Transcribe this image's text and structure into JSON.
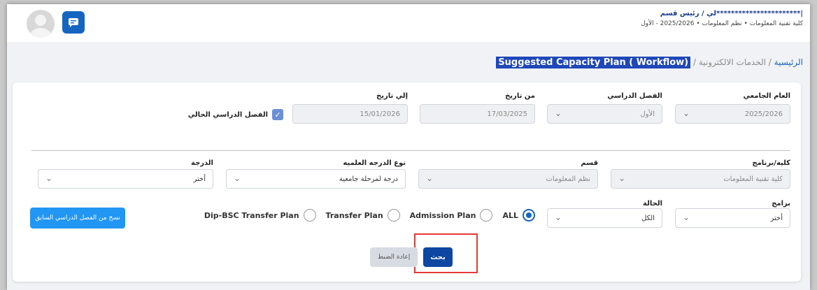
{
  "header": {
    "user_name": "|***********************لي / رئيس قسم",
    "user_meta": "كلية تقنية المعلومات  •  نظم المعلومات  •  2025/2026 - الأول"
  },
  "breadcrumb": {
    "home": "الرئيسية",
    "separator": "/",
    "section": "الخدمات الالكترونية",
    "current": "Suggested Capacity Plan ( Workflow)"
  },
  "filters": {
    "academic_year": {
      "label": "العام الجامعي",
      "value": "2025/2026"
    },
    "semester": {
      "label": "الفصل الدراسي",
      "value": "الأول"
    },
    "from_date": {
      "label": "من تاريخ",
      "value": "17/03/2025"
    },
    "to_date": {
      "label": "إلي تاريخ",
      "value": "15/01/2026"
    },
    "current_semester": {
      "label": "الفصل الدراسي الحالي",
      "checked": true
    },
    "college": {
      "label": "كليه/برنامج",
      "value": "كلية تقنية المعلومات"
    },
    "department": {
      "label": "قسم",
      "value": "نظم المعلومات"
    },
    "degree_type": {
      "label": "نوع الدرجه العلميه",
      "value": "درجة لمرحلة جامعية"
    },
    "degree": {
      "label": "الدرجة",
      "value": "أختر"
    },
    "programs": {
      "label": "برامج",
      "value": "أختر"
    },
    "status": {
      "label": "الحالة",
      "value": "الكل"
    }
  },
  "plan_types": [
    {
      "label": "ALL",
      "selected": true
    },
    {
      "label": "Admission Plan",
      "selected": false
    },
    {
      "label": "Transfer Plan",
      "selected": false
    },
    {
      "label": "Dip-BSC Transfer Plan",
      "selected": false
    }
  ],
  "buttons": {
    "copy": "نسخ من الفصل الدراسي السابق",
    "search": "بحث",
    "reset": "إعادة الضبط"
  },
  "colors": {
    "primary": "#1565c0",
    "highlight": "#e53935",
    "breadcrumb_highlight": "#1e47b8"
  },
  "icons": {
    "chat": "chat-icon",
    "avatar": "user-avatar-icon",
    "dropdown": "chevron-down-icon",
    "check": "check-icon"
  }
}
